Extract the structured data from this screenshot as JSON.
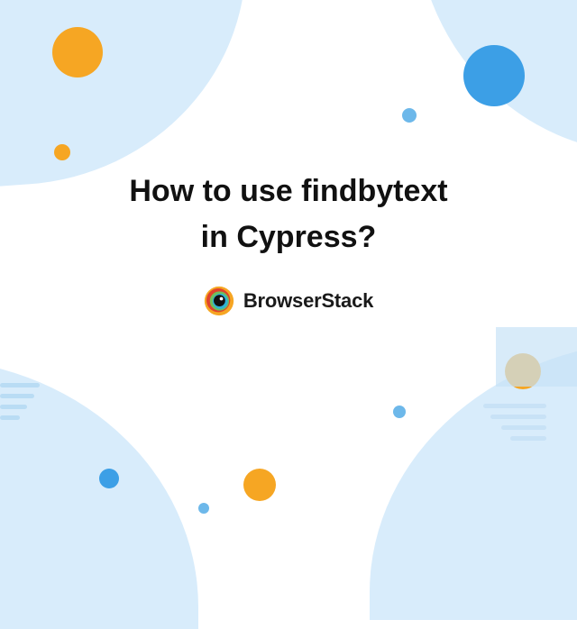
{
  "title_line1": "How to use findbytext",
  "title_line2": "in Cypress?",
  "brand_name": "BrowserStack",
  "colors": {
    "orange": "#f6a623",
    "blue": "#3c9fe6",
    "light_blue": "#d8ecfb"
  }
}
